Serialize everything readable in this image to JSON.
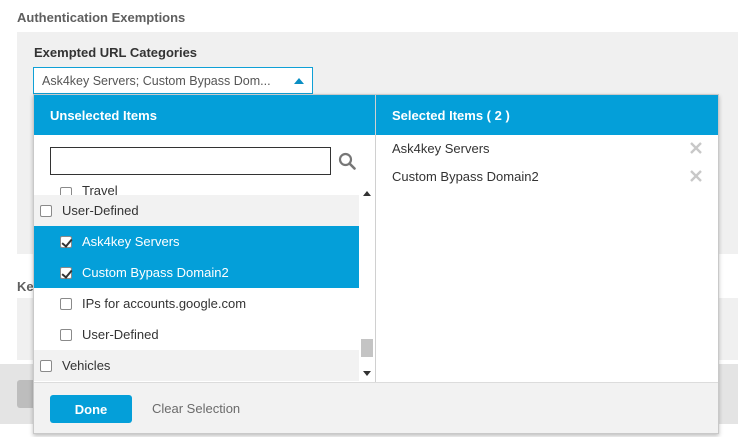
{
  "section": {
    "title": "Authentication Exemptions",
    "second_title_partial": "Ke"
  },
  "field": {
    "label": "Exempted URL Categories",
    "value": "Ask4key Servers; Custom Bypass Dom..."
  },
  "dropdown": {
    "unselected_header": "Unselected Items",
    "selected_header": "Selected Items ( 2 )",
    "search": {
      "value": "",
      "placeholder": ""
    },
    "list": [
      {
        "label": "Travel",
        "checked": false,
        "group": false,
        "selected": false
      },
      {
        "label": "User-Defined",
        "checked": false,
        "group": true,
        "selected": false
      },
      {
        "label": "Ask4key Servers",
        "checked": true,
        "group": false,
        "selected": true
      },
      {
        "label": "Custom Bypass Domain2",
        "checked": true,
        "group": false,
        "selected": true
      },
      {
        "label": "IPs for accounts.google.com",
        "checked": false,
        "group": false,
        "selected": false
      },
      {
        "label": "User-Defined",
        "checked": false,
        "group": false,
        "selected": false
      },
      {
        "label": "Vehicles",
        "checked": false,
        "group": true,
        "selected": false
      }
    ],
    "selected_items": [
      "Ask4key Servers",
      "Custom Bypass Domain2"
    ],
    "done_label": "Done",
    "clear_label": "Clear Selection"
  },
  "colors": {
    "accent": "#049fd9",
    "panel_bg": "#f0f0f0"
  },
  "icons": {
    "search": "search-icon",
    "remove": "close-icon",
    "caret": "caret-up-icon"
  }
}
